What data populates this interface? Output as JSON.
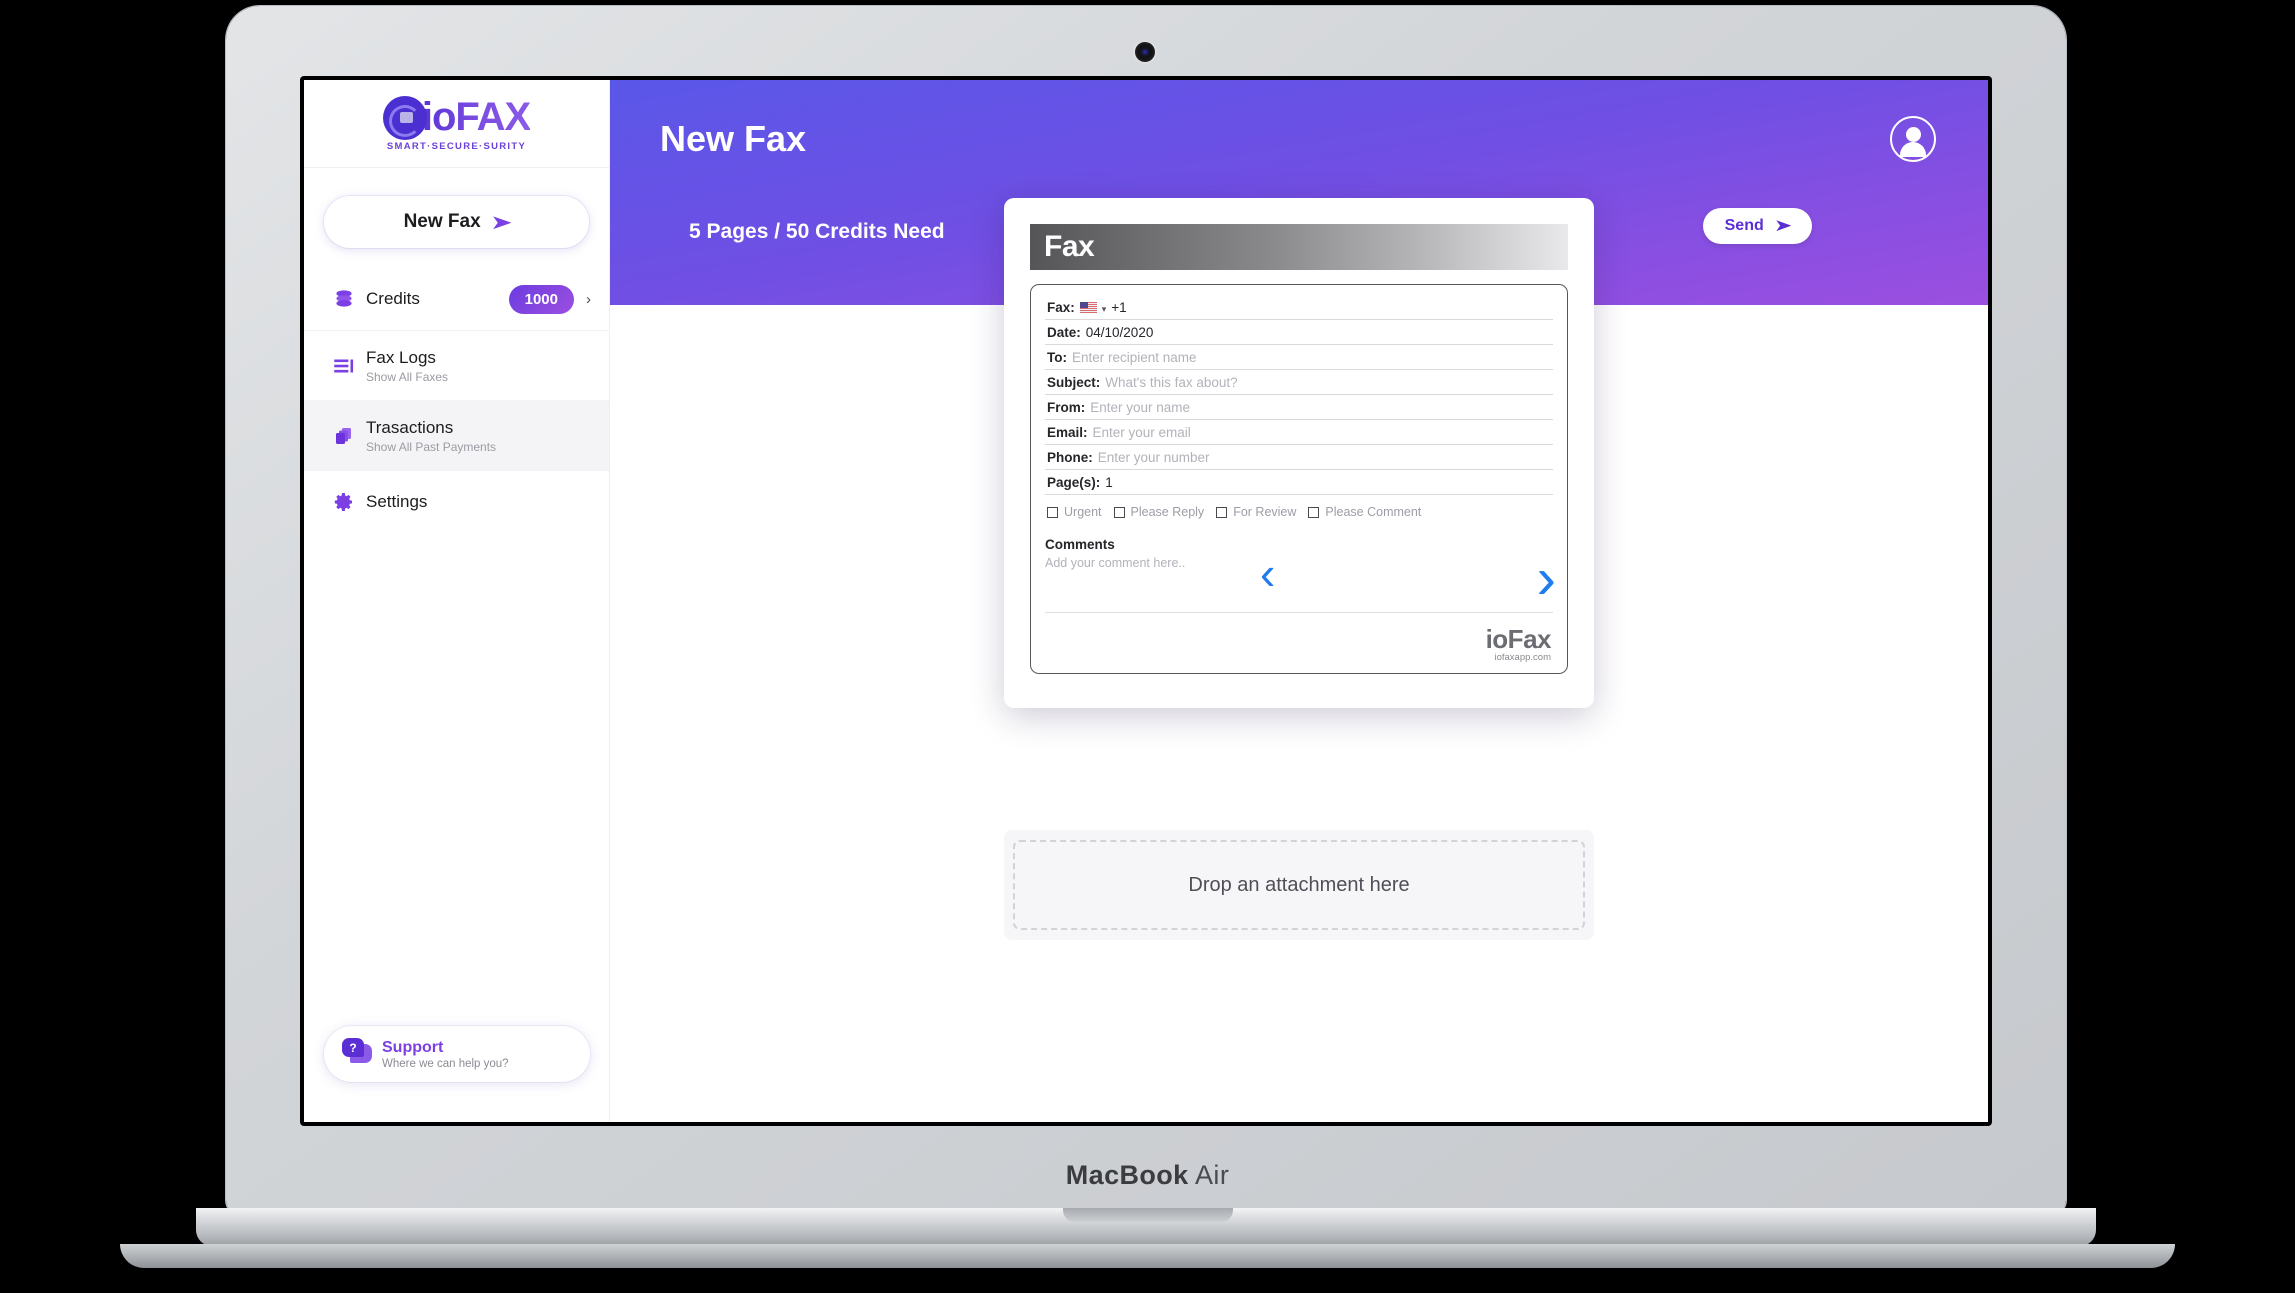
{
  "device": {
    "brand_bold": "MacBook",
    "brand_light": "Air"
  },
  "sidebar": {
    "logo": {
      "text": "ioFAX",
      "tagline": "SMART·SECURE·SURITY"
    },
    "new_fax_button": {
      "label": "New Fax",
      "icon": "send-arrow-icon"
    },
    "menu": [
      {
        "title": "Credits",
        "sub": "",
        "badge": "1000",
        "chevron": "›",
        "icon": "coins-icon",
        "active": false
      },
      {
        "title": "Fax Logs",
        "sub": "Show All Faxes",
        "badge": "",
        "chevron": "",
        "icon": "list-icon",
        "active": false
      },
      {
        "title": "Trasactions",
        "sub": "Show All Past Payments",
        "badge": "",
        "chevron": "",
        "icon": "cards-stack-icon",
        "active": true
      },
      {
        "title": "Settings",
        "sub": "",
        "badge": "",
        "chevron": "",
        "icon": "gear-icon",
        "active": false
      }
    ],
    "support": {
      "title": "Support",
      "sub": "Where we can help you?",
      "icon": "chat-question-icon",
      "badge_glyph": "?"
    }
  },
  "header": {
    "title": "New Fax",
    "status": "5 Pages / 50 Credits Need",
    "send_button": {
      "label": "Send",
      "icon": "send-arrow-icon"
    },
    "avatar": "user-avatar-icon",
    "gradient_from": "#5a57e8",
    "gradient_to": "#9b4fe0"
  },
  "document": {
    "header_title": "Fax",
    "fields": [
      {
        "key": "Fax:",
        "value": "+1",
        "placeholder": "",
        "has_flag": true,
        "flag": "us-flag-icon",
        "caret": "▾"
      },
      {
        "key": "Date:",
        "value": "04/10/2020",
        "placeholder": "",
        "has_flag": false
      },
      {
        "key": "To:",
        "value": "",
        "placeholder": "Enter recipient name",
        "has_flag": false
      },
      {
        "key": "Subject:",
        "value": "",
        "placeholder": "What's this fax about?",
        "has_flag": false
      },
      {
        "key": "From:",
        "value": "",
        "placeholder": "Enter your name",
        "has_flag": false
      },
      {
        "key": "Email:",
        "value": "",
        "placeholder": "Enter your email",
        "has_flag": false
      },
      {
        "key": "Phone:",
        "value": "",
        "placeholder": "Enter your number",
        "has_flag": false
      },
      {
        "key": "Page(s):",
        "value": "1",
        "placeholder": "",
        "has_flag": false
      }
    ],
    "checkboxes": [
      {
        "label": "Urgent",
        "checked": false
      },
      {
        "label": "Please Reply",
        "checked": false
      },
      {
        "label": "For Review",
        "checked": false
      },
      {
        "label": "Please Comment",
        "checked": false
      }
    ],
    "comments": {
      "title": "Comments",
      "placeholder": "Add your comment here.."
    },
    "footer": {
      "logo": "ioFax",
      "url": "iofaxapp.com"
    }
  },
  "nav": {
    "prev": "‹",
    "next": "›"
  },
  "dropzone": {
    "label": "Drop an attachment here"
  }
}
